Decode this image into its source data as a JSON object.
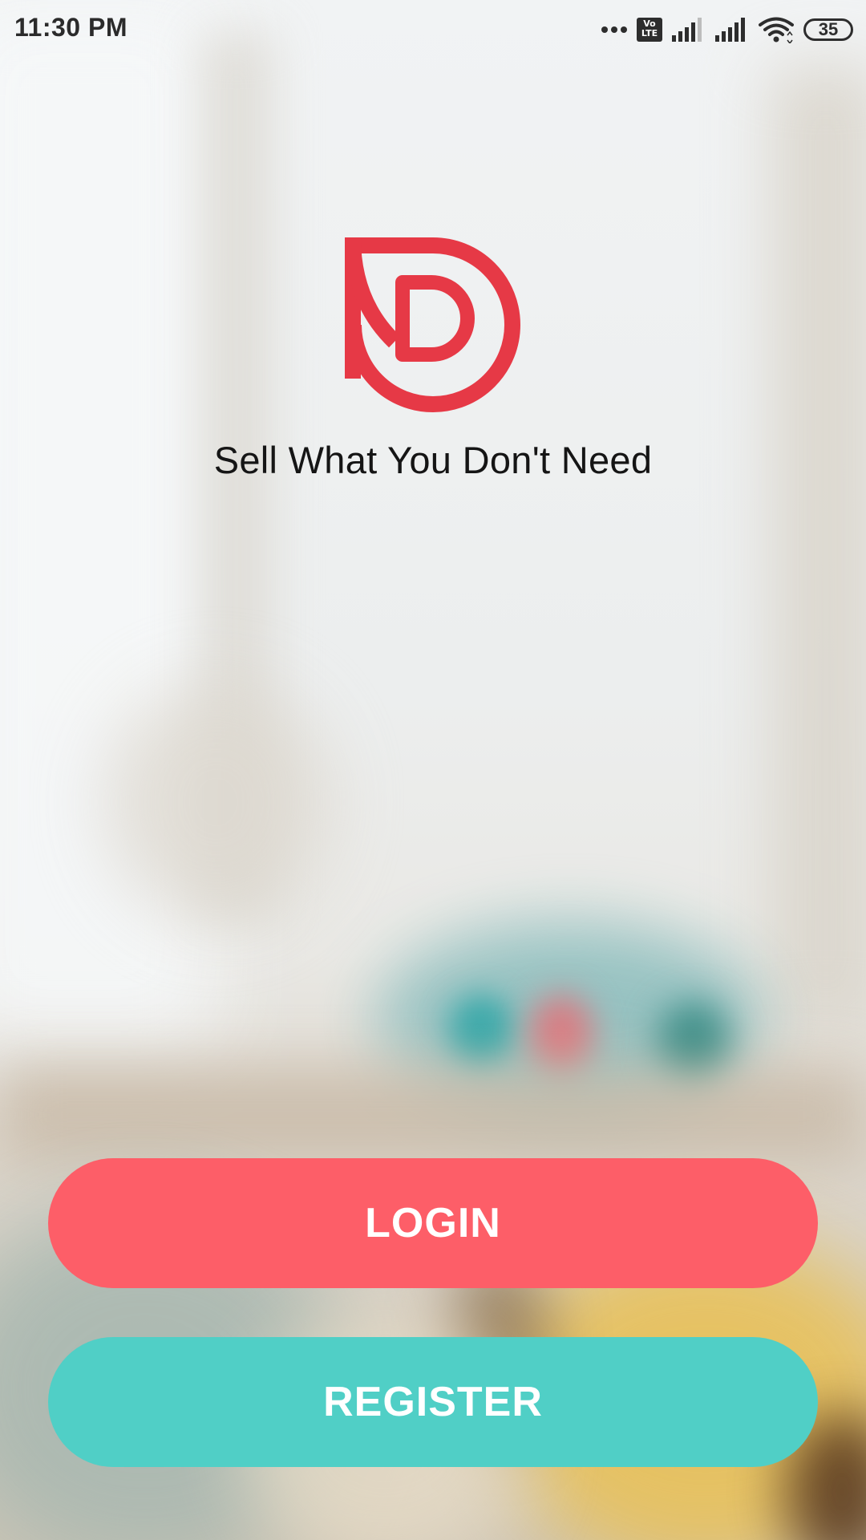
{
  "status_bar": {
    "time": "11:30 PM",
    "network_badge": "Vo\nLTE",
    "battery": "35",
    "icons": [
      "more-dots-icon",
      "volte-icon",
      "signal-icon",
      "signal-icon",
      "wifi-icon",
      "battery-icon"
    ]
  },
  "brand": {
    "logo": "brand-logo-icon",
    "tagline": "Sell What You Don't Need"
  },
  "actions": {
    "login_label": "LOGIN",
    "register_label": "REGISTER"
  },
  "colors": {
    "brand_red": "#e63946",
    "login_bg": "#fd5e68",
    "register_bg": "#50cfc6",
    "text_dark": "#151515"
  }
}
